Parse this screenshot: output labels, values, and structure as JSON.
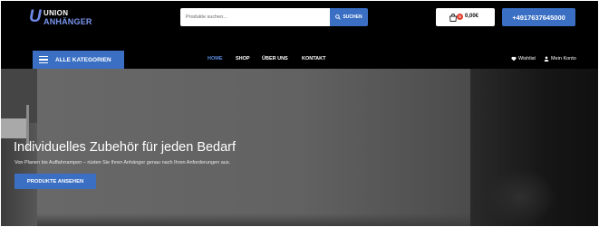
{
  "header": {
    "logo": {
      "mark": "U",
      "line1": "UNION",
      "line2": "ANHÄNGER"
    },
    "search": {
      "placeholder": "Produkte suchen...",
      "value": "",
      "button_label": "SUCHEN"
    },
    "cart": {
      "count": "0",
      "total": "0,00€"
    },
    "phone_label": "+4917637645000"
  },
  "nav": {
    "categories_label": "ALLE KATEGORIEN",
    "menu": [
      {
        "label": "HOME",
        "active": true
      },
      {
        "label": "SHOP",
        "active": false
      },
      {
        "label": "ÜBER UNS",
        "active": false
      },
      {
        "label": "KONTAKT",
        "active": false
      }
    ],
    "wishlist_label": "Wishlist",
    "account_label": "Mein Konto"
  },
  "hero": {
    "title": "Individuelles Zubehör für jeden Bedarf",
    "subtitle": "Von Planen bis Auffahrrampen – rüsten Sie Ihren Anhänger genau nach Ihren Anforderungen aus.",
    "cta_label": "PRODUKTE ANSEHEN"
  },
  "colors": {
    "accent": "#3a6fc4",
    "active_menu": "#5b8be0",
    "badge": "#e23a2a",
    "background": "#000000"
  }
}
